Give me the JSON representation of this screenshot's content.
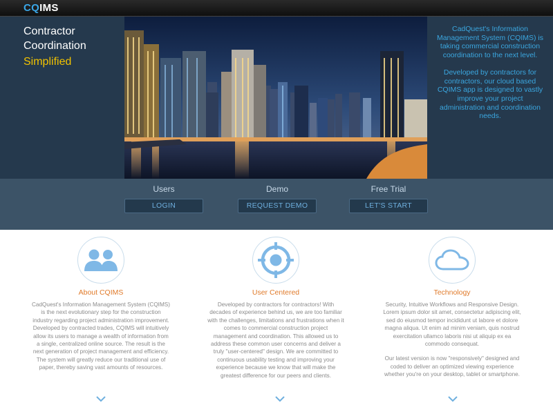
{
  "header": {
    "logo_cq": "CQ",
    "logo_ims": "IMS"
  },
  "hero": {
    "title_line1": "Contractor",
    "title_line2": "Coordination",
    "title_accent": "Simplified",
    "description_1": "CadQuest's Information Management System (CQIMS) is taking commercial construction coordination to the next level.",
    "description_2": "Developed by contractors for contractors, our cloud based CQIMS app is designed to vastly improve your project administration and coordination needs."
  },
  "actions": [
    {
      "label": "Users",
      "button": "LOGIN"
    },
    {
      "label": "Demo",
      "button": "REQUEST DEMO"
    },
    {
      "label": "Free Trial",
      "button": "LET'S START"
    }
  ],
  "features": [
    {
      "icon": "users-icon",
      "title": "About CQIMS",
      "paragraphs": [
        "CadQuest's Information Management System (CQIMS) is the next evolutionary step for the construction industry regarding project administration improvement. Developed by contracted trades, CQIMS will intuitively allow its users to manage a wealth of information from a single, centralized online source. The result is the next generation of project management and efficiency. The system will greatly reduce our traditional use of paper, thereby saving vast amounts of resources."
      ]
    },
    {
      "icon": "target-icon",
      "title": "User Centered",
      "paragraphs": [
        "Developed by contractors for contractors! With decades of experience behind us, we are too familiar with the challenges, limitations and frustrations when it comes to commercial construction project management and coordination. This allowed us to address these common user concerns and deliver a truly \"user-centered\" design. We are committed to continuous usability testing and improving your experience because we know that will make the greatest difference for our peers and clients."
      ]
    },
    {
      "icon": "cloud-icon",
      "title": "Technology",
      "paragraphs": [
        "Security, Intuitive Workflows and Responsive Design. Lorem ipsum dolor sit amet, consectetur adipiscing elit, sed do eiusmod tempor incididunt ut labore et dolore magna aliqua. Ut enim ad minim veniam, quis nostrud exercitation ullamco laboris nisi ut aliquip ex ea commodo consequat.",
        "Our latest version is now \"responsively\" designed and coded to deliver an optimized viewing experience whether you're on your desktop, tablet or smartphone."
      ]
    }
  ],
  "colors": {
    "accent_blue": "#3aa7e8",
    "accent_yellow": "#f2c300",
    "feature_title": "#e07a2a"
  }
}
